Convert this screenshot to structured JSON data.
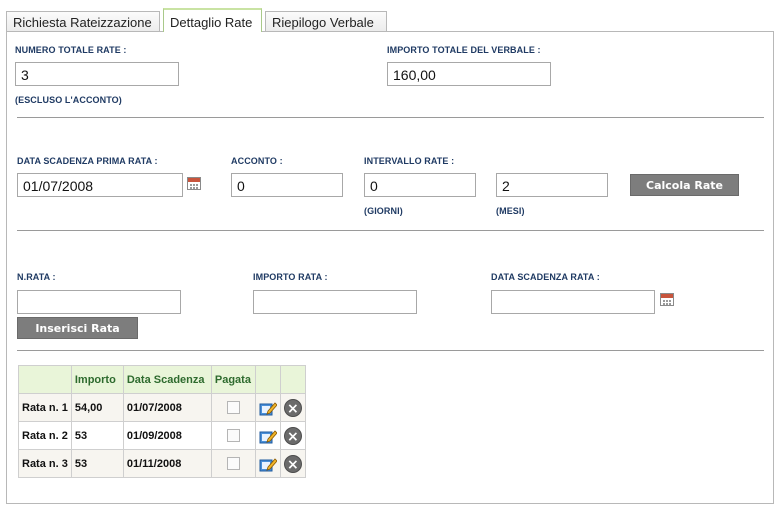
{
  "tabs": [
    {
      "label": "Richiesta Rateizzazione",
      "active": false
    },
    {
      "label": "Dettaglio Rate",
      "active": true
    },
    {
      "label": "Riepilogo Verbale",
      "active": false
    }
  ],
  "summary": {
    "num_rate_label": "NUMERO TOTALE RATE :",
    "num_rate_value": "3",
    "num_rate_note": "(ESCLUSO L'ACCONTO)",
    "importo_label": "IMPORTO TOTALE DEL VERBALE :",
    "importo_value": "160,00"
  },
  "calc": {
    "data_label": "DATA SCADENZA PRIMA RATA :",
    "data_value": "01/07/2008",
    "acconto_label": "ACCONTO :",
    "acconto_value": "0",
    "intervallo_label": "INTERVALLO RATE :",
    "giorni_value": "0",
    "giorni_note": "(GIORNI)",
    "mesi_value": "2",
    "mesi_note": "(MESI)",
    "button_label": "Calcola Rate"
  },
  "insert": {
    "nrata_label": "N.RATA :",
    "nrata_value": "",
    "importo_label": "IMPORTO RATA :",
    "importo_value": "",
    "data_label": "DATA SCADENZA RATA :",
    "data_value": "",
    "button_label": "Inserisci Rata"
  },
  "table": {
    "headers": [
      "",
      "Importo",
      "Data Scadenza",
      "Pagata",
      "",
      ""
    ],
    "rows": [
      {
        "label": "Rata n. 1",
        "importo": "54,00",
        "data": "01/07/2008",
        "pagata": false
      },
      {
        "label": "Rata n. 2",
        "importo": "53",
        "data": "01/09/2008",
        "pagata": false
      },
      {
        "label": "Rata n. 3",
        "importo": "53",
        "data": "01/11/2008",
        "pagata": false
      }
    ]
  },
  "icons": {
    "calendar": "calendar-icon",
    "edit": "edit-icon",
    "delete": "delete-icon"
  },
  "colors": {
    "label_text": "#1f3a63",
    "button_bg": "#7d7d7d",
    "table_header_bg": "#e9f5d9",
    "table_header_text": "#2e6b2e"
  }
}
